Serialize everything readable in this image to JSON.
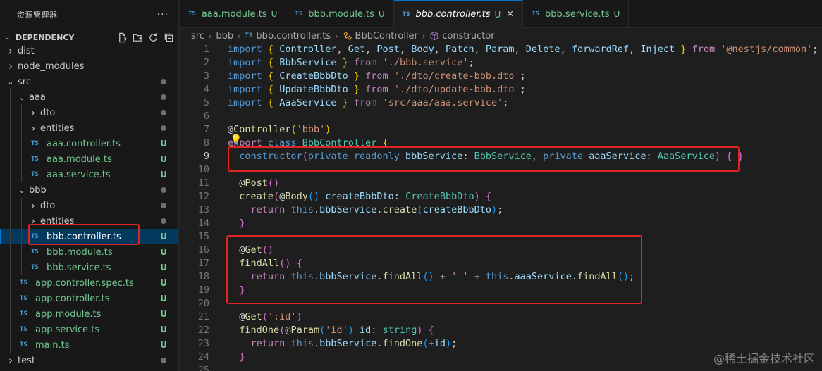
{
  "sidebar": {
    "title": "资源管理器",
    "more": "···",
    "section": "DEPENDENCY",
    "actions": [
      "new-file-icon",
      "new-folder-icon",
      "refresh-icon",
      "collapse-all-icon"
    ],
    "tree": [
      {
        "label": "dist",
        "kind": "folder",
        "open": false,
        "depth": 0
      },
      {
        "label": "node_modules",
        "kind": "folder",
        "open": false,
        "depth": 0
      },
      {
        "label": "src",
        "kind": "folder",
        "open": true,
        "depth": 0,
        "dot": true
      },
      {
        "label": "aaa",
        "kind": "folder",
        "open": true,
        "depth": 1,
        "dot": true
      },
      {
        "label": "dto",
        "kind": "folder",
        "open": false,
        "depth": 2,
        "dot": true
      },
      {
        "label": "entities",
        "kind": "folder",
        "open": false,
        "depth": 2,
        "dot": true
      },
      {
        "label": "aaa.controller.ts",
        "kind": "ts",
        "depth": 2,
        "status": "U"
      },
      {
        "label": "aaa.module.ts",
        "kind": "ts",
        "depth": 2,
        "status": "U"
      },
      {
        "label": "aaa.service.ts",
        "kind": "ts",
        "depth": 2,
        "status": "U"
      },
      {
        "label": "bbb",
        "kind": "folder",
        "open": true,
        "depth": 1,
        "dot": true
      },
      {
        "label": "dto",
        "kind": "folder",
        "open": false,
        "depth": 2,
        "dot": true
      },
      {
        "label": "entities",
        "kind": "folder",
        "open": false,
        "depth": 2,
        "dot": true
      },
      {
        "label": "bbb.controller.ts",
        "kind": "ts",
        "depth": 2,
        "status": "U",
        "selected": true
      },
      {
        "label": "bbb.module.ts",
        "kind": "ts",
        "depth": 2,
        "status": "U"
      },
      {
        "label": "bbb.service.ts",
        "kind": "ts",
        "depth": 2,
        "status": "U"
      },
      {
        "label": "app.controller.spec.ts",
        "kind": "ts",
        "depth": 1,
        "status": "U"
      },
      {
        "label": "app.controller.ts",
        "kind": "ts",
        "depth": 1,
        "status": "U"
      },
      {
        "label": "app.module.ts",
        "kind": "ts",
        "depth": 1,
        "status": "U"
      },
      {
        "label": "app.service.ts",
        "kind": "ts",
        "depth": 1,
        "status": "U"
      },
      {
        "label": "main.ts",
        "kind": "ts",
        "depth": 1,
        "status": "U"
      },
      {
        "label": "test",
        "kind": "folder",
        "open": false,
        "depth": 0,
        "dot": true
      }
    ]
  },
  "tabs": [
    {
      "icon": "TS",
      "name": "aaa.module.ts",
      "status": "U",
      "active": false
    },
    {
      "icon": "TS",
      "name": "bbb.module.ts",
      "status": "U",
      "active": false
    },
    {
      "icon": "TS",
      "name": "bbb.controller.ts",
      "status": "U",
      "active": true,
      "close": "✕"
    },
    {
      "icon": "TS",
      "name": "bbb.service.ts",
      "status": "U",
      "active": false
    }
  ],
  "breadcrumb": {
    "parts": [
      "src",
      "bbb",
      "bbb.controller.ts",
      "BbbController",
      "constructor"
    ],
    "ts_icon": "TS",
    "sep": "›"
  },
  "editor": {
    "current_line": 9,
    "lines": [
      [
        [
          "k",
          "import"
        ],
        [
          "p",
          " "
        ],
        [
          "b1",
          "{"
        ],
        [
          "p",
          " "
        ],
        [
          "v",
          "Controller"
        ],
        [
          "p",
          ", "
        ],
        [
          "v",
          "Get"
        ],
        [
          "p",
          ", "
        ],
        [
          "v",
          "Post"
        ],
        [
          "p",
          ", "
        ],
        [
          "v",
          "Body"
        ],
        [
          "p",
          ", "
        ],
        [
          "v",
          "Patch"
        ],
        [
          "p",
          ", "
        ],
        [
          "v",
          "Param"
        ],
        [
          "p",
          ", "
        ],
        [
          "v",
          "Delete"
        ],
        [
          "p",
          ", "
        ],
        [
          "v",
          "forwardRef"
        ],
        [
          "p",
          ", "
        ],
        [
          "v",
          "Inject"
        ],
        [
          "p",
          " "
        ],
        [
          "b1",
          "}"
        ],
        [
          "p",
          " "
        ],
        [
          "kc",
          "from"
        ],
        [
          "p",
          " "
        ],
        [
          "s",
          "'@nestjs/common'"
        ],
        [
          "p",
          ";"
        ]
      ],
      [
        [
          "k",
          "import"
        ],
        [
          "p",
          " "
        ],
        [
          "b1",
          "{"
        ],
        [
          "p",
          " "
        ],
        [
          "v",
          "BbbService"
        ],
        [
          "p",
          " "
        ],
        [
          "b1",
          "}"
        ],
        [
          "p",
          " "
        ],
        [
          "kc",
          "from"
        ],
        [
          "p",
          " "
        ],
        [
          "s",
          "'./bbb.service'"
        ],
        [
          "p",
          ";"
        ]
      ],
      [
        [
          "k",
          "import"
        ],
        [
          "p",
          " "
        ],
        [
          "b1",
          "{"
        ],
        [
          "p",
          " "
        ],
        [
          "v",
          "CreateBbbDto"
        ],
        [
          "p",
          " "
        ],
        [
          "b1",
          "}"
        ],
        [
          "p",
          " "
        ],
        [
          "kc",
          "from"
        ],
        [
          "p",
          " "
        ],
        [
          "s",
          "'./dto/create-bbb.dto'"
        ],
        [
          "p",
          ";"
        ]
      ],
      [
        [
          "k",
          "import"
        ],
        [
          "p",
          " "
        ],
        [
          "b1",
          "{"
        ],
        [
          "p",
          " "
        ],
        [
          "v",
          "UpdateBbbDto"
        ],
        [
          "p",
          " "
        ],
        [
          "b1",
          "}"
        ],
        [
          "p",
          " "
        ],
        [
          "kc",
          "from"
        ],
        [
          "p",
          " "
        ],
        [
          "s",
          "'./dto/update-bbb.dto'"
        ],
        [
          "p",
          ";"
        ]
      ],
      [
        [
          "k",
          "import"
        ],
        [
          "p",
          " "
        ],
        [
          "b1",
          "{"
        ],
        [
          "p",
          " "
        ],
        [
          "v",
          "AaaService"
        ],
        [
          "p",
          " "
        ],
        [
          "b1",
          "}"
        ],
        [
          "p",
          " "
        ],
        [
          "kc",
          "from"
        ],
        [
          "p",
          " "
        ],
        [
          "s",
          "'src/aaa/aaa.service'"
        ],
        [
          "p",
          ";"
        ]
      ],
      [],
      [
        [
          "p",
          "@"
        ],
        [
          "f",
          "Controller"
        ],
        [
          "b1",
          "("
        ],
        [
          "s",
          "'bbb'"
        ],
        [
          "b1",
          ")"
        ]
      ],
      [
        [
          "kc",
          "export"
        ],
        [
          "p",
          " "
        ],
        [
          "k",
          "class"
        ],
        [
          "p",
          " "
        ],
        [
          "c",
          "BbbController"
        ],
        [
          "p",
          " "
        ],
        [
          "b1",
          "{"
        ]
      ],
      [
        [
          "p",
          "  "
        ],
        [
          "k",
          "constructor"
        ],
        [
          "b2",
          "("
        ],
        [
          "k",
          "private"
        ],
        [
          "p",
          " "
        ],
        [
          "k",
          "readonly"
        ],
        [
          "p",
          " "
        ],
        [
          "v",
          "bbbService"
        ],
        [
          "p",
          ": "
        ],
        [
          "c",
          "BbbService"
        ],
        [
          "p",
          ", "
        ],
        [
          "k",
          "private"
        ],
        [
          "p",
          " "
        ],
        [
          "v",
          "aaaService"
        ],
        [
          "p",
          ": "
        ],
        [
          "c",
          "AaaService"
        ],
        [
          "b2",
          ")"
        ],
        [
          "p",
          " "
        ],
        [
          "b2",
          "{"
        ],
        [
          "p",
          " "
        ],
        [
          "b2",
          "}"
        ]
      ],
      [],
      [
        [
          "p",
          "  @"
        ],
        [
          "f",
          "Post"
        ],
        [
          "b2",
          "()"
        ]
      ],
      [
        [
          "p",
          "  "
        ],
        [
          "f",
          "create"
        ],
        [
          "b2",
          "("
        ],
        [
          "p",
          "@"
        ],
        [
          "f",
          "Body"
        ],
        [
          "b3",
          "()"
        ],
        [
          "p",
          " "
        ],
        [
          "v",
          "createBbbDto"
        ],
        [
          "p",
          ": "
        ],
        [
          "c",
          "CreateBbbDto"
        ],
        [
          "b2",
          ")"
        ],
        [
          "p",
          " "
        ],
        [
          "b2",
          "{"
        ]
      ],
      [
        [
          "p",
          "    "
        ],
        [
          "kc",
          "return"
        ],
        [
          "p",
          " "
        ],
        [
          "k",
          "this"
        ],
        [
          "p",
          "."
        ],
        [
          "v",
          "bbbService"
        ],
        [
          "p",
          "."
        ],
        [
          "f",
          "create"
        ],
        [
          "b3",
          "("
        ],
        [
          "v",
          "createBbbDto"
        ],
        [
          "b3",
          ")"
        ],
        [
          "p",
          ";"
        ]
      ],
      [
        [
          "p",
          "  "
        ],
        [
          "b2",
          "}"
        ]
      ],
      [],
      [
        [
          "p",
          "  @"
        ],
        [
          "f",
          "Get"
        ],
        [
          "b2",
          "()"
        ]
      ],
      [
        [
          "p",
          "  "
        ],
        [
          "f",
          "findAll"
        ],
        [
          "b2",
          "()"
        ],
        [
          "p",
          " "
        ],
        [
          "b2",
          "{"
        ]
      ],
      [
        [
          "p",
          "    "
        ],
        [
          "kc",
          "return"
        ],
        [
          "p",
          " "
        ],
        [
          "k",
          "this"
        ],
        [
          "p",
          "."
        ],
        [
          "v",
          "bbbService"
        ],
        [
          "p",
          "."
        ],
        [
          "f",
          "findAll"
        ],
        [
          "b3",
          "()"
        ],
        [
          "p",
          " + "
        ],
        [
          "s",
          "' '"
        ],
        [
          "p",
          " + "
        ],
        [
          "k",
          "this"
        ],
        [
          "p",
          "."
        ],
        [
          "v",
          "aaaService"
        ],
        [
          "p",
          "."
        ],
        [
          "f",
          "findAll"
        ],
        [
          "b3",
          "()"
        ],
        [
          "p",
          ";"
        ]
      ],
      [
        [
          "p",
          "  "
        ],
        [
          "b2",
          "}"
        ]
      ],
      [],
      [
        [
          "p",
          "  @"
        ],
        [
          "f",
          "Get"
        ],
        [
          "b2",
          "("
        ],
        [
          "s",
          "':id'"
        ],
        [
          "b2",
          ")"
        ]
      ],
      [
        [
          "p",
          "  "
        ],
        [
          "f",
          "findOne"
        ],
        [
          "b2",
          "("
        ],
        [
          "p",
          "@"
        ],
        [
          "f",
          "Param"
        ],
        [
          "b3",
          "("
        ],
        [
          "s",
          "'id'"
        ],
        [
          "b3",
          ")"
        ],
        [
          "p",
          " "
        ],
        [
          "v",
          "id"
        ],
        [
          "p",
          ": "
        ],
        [
          "c",
          "string"
        ],
        [
          "b2",
          ")"
        ],
        [
          "p",
          " "
        ],
        [
          "b2",
          "{"
        ]
      ],
      [
        [
          "p",
          "    "
        ],
        [
          "kc",
          "return"
        ],
        [
          "p",
          " "
        ],
        [
          "k",
          "this"
        ],
        [
          "p",
          "."
        ],
        [
          "v",
          "bbbService"
        ],
        [
          "p",
          "."
        ],
        [
          "f",
          "findOne"
        ],
        [
          "b3",
          "("
        ],
        [
          "p",
          "+"
        ],
        [
          "v",
          "id"
        ],
        [
          "b3",
          ")"
        ],
        [
          "p",
          ";"
        ]
      ],
      [
        [
          "p",
          "  "
        ],
        [
          "b2",
          "}"
        ]
      ],
      []
    ]
  },
  "watermark": "@稀土掘金技术社区"
}
